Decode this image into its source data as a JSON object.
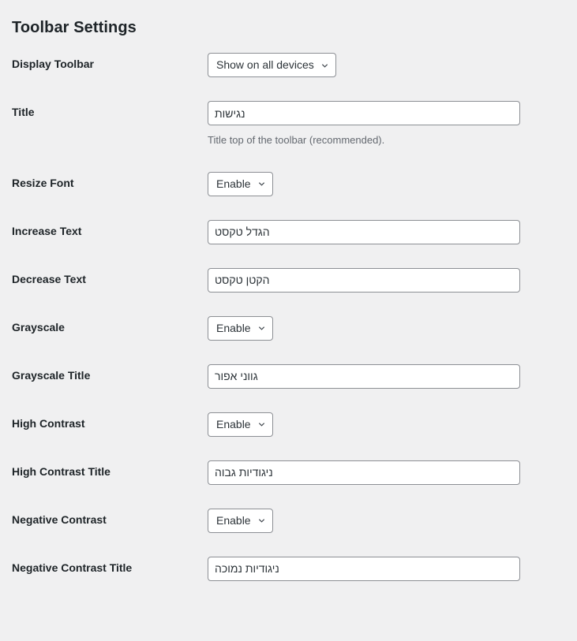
{
  "page": {
    "title": "Toolbar Settings"
  },
  "icons": {
    "chevron_down": "chevron-down-icon"
  },
  "rows": [
    {
      "key": "display_toolbar",
      "label": "Display Toolbar",
      "type": "select",
      "value": "Show on all devices",
      "description": ""
    },
    {
      "key": "title",
      "label": "Title",
      "type": "text",
      "value": "נגישות",
      "placeholder": "",
      "description": "Title top of the toolbar (recommended)."
    },
    {
      "key": "resize_font",
      "label": "Resize Font",
      "type": "select",
      "value": "Enable",
      "description": ""
    },
    {
      "key": "increase_text",
      "label": "Increase Text",
      "type": "text",
      "value": "הגדל טקסט",
      "placeholder": "",
      "description": ""
    },
    {
      "key": "decrease_text",
      "label": "Decrease Text",
      "type": "text",
      "value": "הקטן טקסט",
      "placeholder": "",
      "description": ""
    },
    {
      "key": "grayscale",
      "label": "Grayscale",
      "type": "select",
      "value": "Enable",
      "description": ""
    },
    {
      "key": "grayscale_title",
      "label": "Grayscale Title",
      "type": "text",
      "value": "גווני אפור",
      "placeholder": "",
      "description": ""
    },
    {
      "key": "high_contrast",
      "label": "High Contrast",
      "type": "select",
      "value": "Enable",
      "description": ""
    },
    {
      "key": "high_contrast_title",
      "label": "High Contrast Title",
      "type": "text",
      "value": "ניגודיות גבוה",
      "placeholder": "",
      "description": ""
    },
    {
      "key": "negative_contrast",
      "label": "Negative Contrast",
      "type": "select",
      "value": "Enable",
      "description": ""
    },
    {
      "key": "negative_contrast_title",
      "label": "Negative Contrast Title",
      "type": "text",
      "value": "ניגודיות נמוכה",
      "placeholder": "",
      "description": ""
    }
  ],
  "colors": {
    "background": "#f0f0f1",
    "text": "#1d2327",
    "field_border": "#8c8f94",
    "field_background": "#ffffff",
    "description_text": "#646970"
  }
}
